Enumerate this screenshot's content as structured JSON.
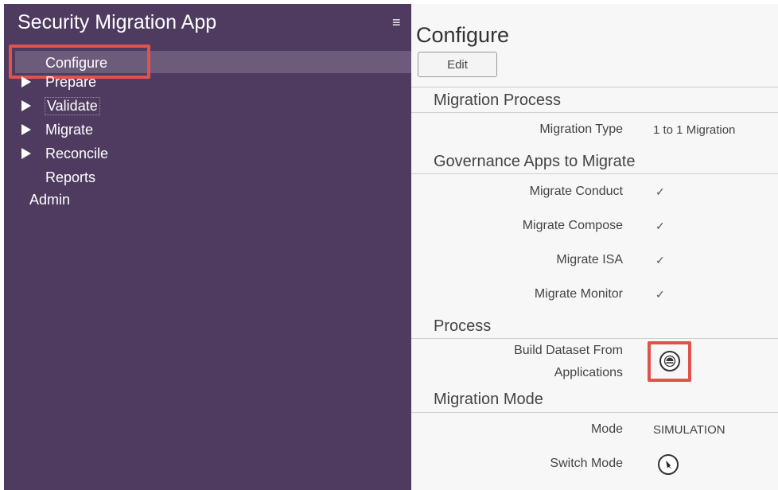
{
  "app": {
    "title": "Security Migration App"
  },
  "sidebar": {
    "items": [
      {
        "label": "Configure"
      },
      {
        "label": "Prepare"
      },
      {
        "label": "Validate"
      },
      {
        "label": "Migrate"
      },
      {
        "label": "Reconcile"
      },
      {
        "label": "Reports"
      },
      {
        "label": "Admin"
      }
    ]
  },
  "main": {
    "title": "Configure",
    "edit_label": "Edit",
    "sections": {
      "migration_process": {
        "title": "Migration Process",
        "migration_type_label": "Migration Type",
        "migration_type_value": "1 to 1 Migration"
      },
      "governance": {
        "title": "Governance Apps to Migrate",
        "items": [
          {
            "label": "Migrate Conduct",
            "checked": true
          },
          {
            "label": "Migrate Compose",
            "checked": true
          },
          {
            "label": "Migrate ISA",
            "checked": true
          },
          {
            "label": "Migrate Monitor",
            "checked": true
          }
        ]
      },
      "process": {
        "title": "Process",
        "build_label_line1": "Build Dataset From",
        "build_label_line2": "Applications"
      },
      "migration_mode": {
        "title": "Migration Mode",
        "mode_label": "Mode",
        "mode_value": "SIMULATION",
        "switch_label": "Switch Mode"
      }
    }
  },
  "icons": {
    "menu": "hamburger-menu-icon",
    "expand": "triangle-right-icon",
    "check": "checkmark-icon",
    "build": "build-dataset-icon",
    "switch": "switch-mode-icon"
  },
  "colors": {
    "sidebar_bg": "#4f3b5f",
    "active_item_bg": "#6d5b7b",
    "highlight": "#e0534a",
    "content_bg": "#f7f7f7"
  }
}
